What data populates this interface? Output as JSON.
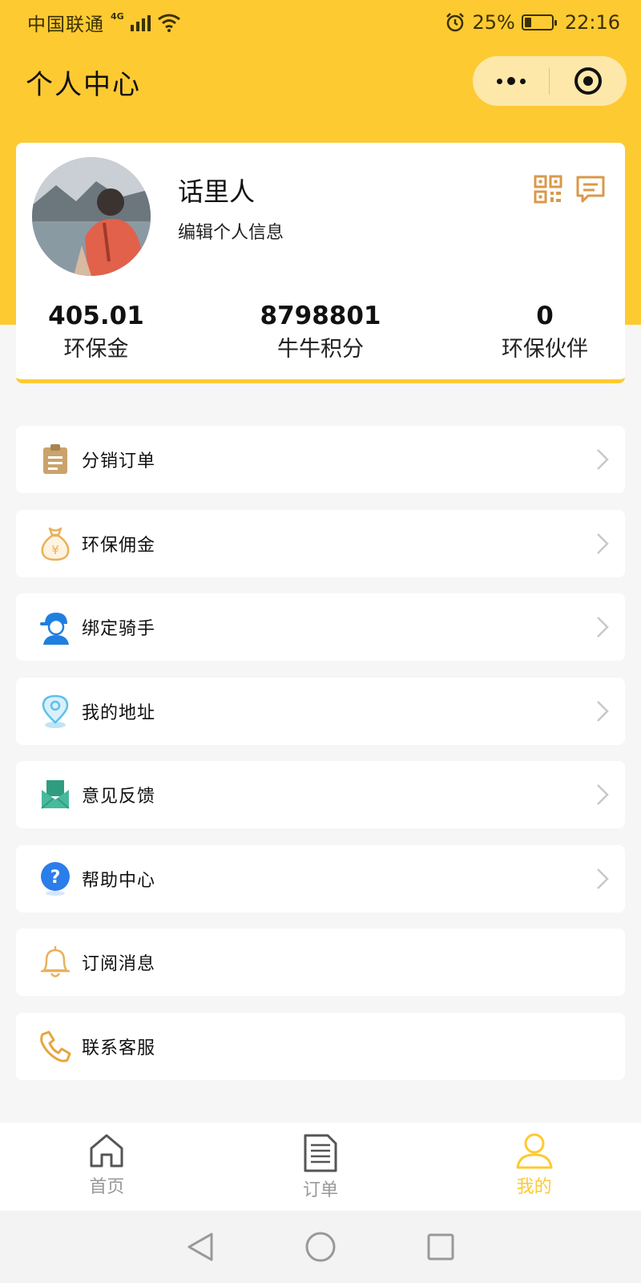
{
  "status_bar": {
    "carrier": "中国联通",
    "network": "4G",
    "battery": "25%",
    "battery_level": 0.25,
    "time": "22:16"
  },
  "header": {
    "title": "个人中心"
  },
  "profile": {
    "username": "话里人",
    "edit_label": "编辑个人信息",
    "stats": [
      {
        "value": "405.01",
        "label": "环保金"
      },
      {
        "value": "8798801",
        "label": "牛牛积分"
      },
      {
        "value": "0",
        "label": "环保伙伴"
      }
    ]
  },
  "menu": [
    {
      "label": "分销订单",
      "icon": "clipboard-icon"
    },
    {
      "label": "环保佣金",
      "icon": "money-bag-icon"
    },
    {
      "label": "绑定骑手",
      "icon": "rider-icon"
    },
    {
      "label": "我的地址",
      "icon": "location-pin-icon"
    },
    {
      "label": "意见反馈",
      "icon": "feedback-envelope-icon"
    },
    {
      "label": "帮助中心",
      "icon": "help-icon"
    },
    {
      "label": "订阅消息",
      "icon": "bell-icon"
    },
    {
      "label": "联系客服",
      "icon": "phone-icon"
    }
  ],
  "tabs": [
    {
      "label": "首页",
      "icon": "home-icon"
    },
    {
      "label": "订单",
      "icon": "document-icon"
    },
    {
      "label": "我的",
      "icon": "user-icon",
      "active": true
    }
  ],
  "colors": {
    "brand_yellow": "#fdca32",
    "icon_orange": "#d9994a"
  }
}
